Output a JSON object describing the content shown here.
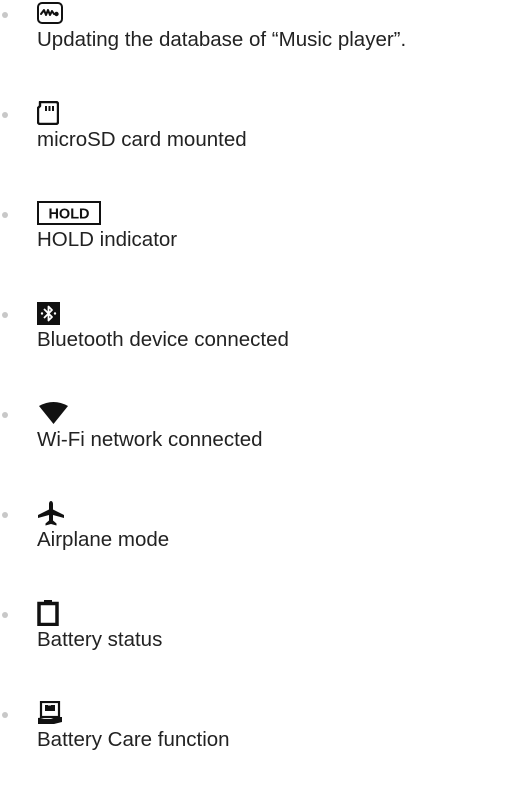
{
  "items": [
    {
      "icon": "music-player-database-icon",
      "label": "Updating the database of “Music player”."
    },
    {
      "icon": "microsd-card-icon",
      "label": "microSD card mounted"
    },
    {
      "icon": "hold-icon",
      "icon_text": "HOLD",
      "label": "HOLD indicator"
    },
    {
      "icon": "bluetooth-icon",
      "label": "Bluetooth device connected"
    },
    {
      "icon": "wifi-icon",
      "label": "Wi-Fi network connected"
    },
    {
      "icon": "airplane-icon",
      "label": "Airplane mode"
    },
    {
      "icon": "battery-icon",
      "label": "Battery status"
    },
    {
      "icon": "battery-care-icon",
      "label": "Battery Care function"
    }
  ]
}
